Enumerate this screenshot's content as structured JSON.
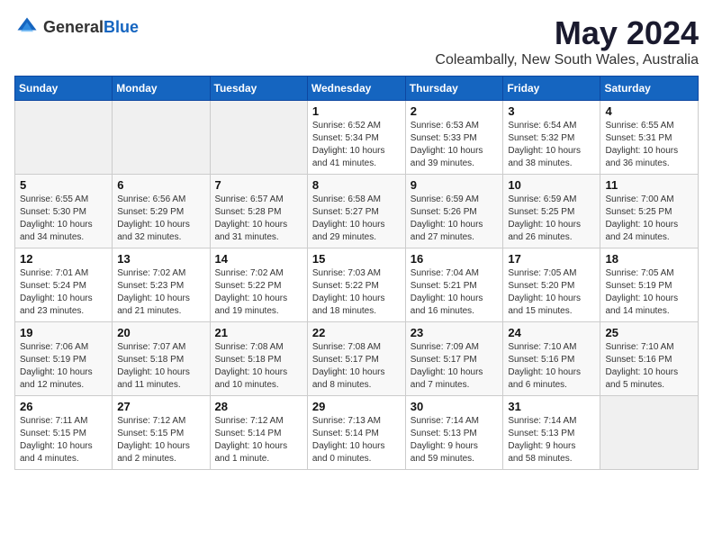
{
  "header": {
    "logo_general": "General",
    "logo_blue": "Blue",
    "title": "May 2024",
    "subtitle": "Coleambally, New South Wales, Australia"
  },
  "weekdays": [
    "Sunday",
    "Monday",
    "Tuesday",
    "Wednesday",
    "Thursday",
    "Friday",
    "Saturday"
  ],
  "weeks": [
    [
      {
        "day": "",
        "info": ""
      },
      {
        "day": "",
        "info": ""
      },
      {
        "day": "",
        "info": ""
      },
      {
        "day": "1",
        "info": "Sunrise: 6:52 AM\nSunset: 5:34 PM\nDaylight: 10 hours\nand 41 minutes."
      },
      {
        "day": "2",
        "info": "Sunrise: 6:53 AM\nSunset: 5:33 PM\nDaylight: 10 hours\nand 39 minutes."
      },
      {
        "day": "3",
        "info": "Sunrise: 6:54 AM\nSunset: 5:32 PM\nDaylight: 10 hours\nand 38 minutes."
      },
      {
        "day": "4",
        "info": "Sunrise: 6:55 AM\nSunset: 5:31 PM\nDaylight: 10 hours\nand 36 minutes."
      }
    ],
    [
      {
        "day": "5",
        "info": "Sunrise: 6:55 AM\nSunset: 5:30 PM\nDaylight: 10 hours\nand 34 minutes."
      },
      {
        "day": "6",
        "info": "Sunrise: 6:56 AM\nSunset: 5:29 PM\nDaylight: 10 hours\nand 32 minutes."
      },
      {
        "day": "7",
        "info": "Sunrise: 6:57 AM\nSunset: 5:28 PM\nDaylight: 10 hours\nand 31 minutes."
      },
      {
        "day": "8",
        "info": "Sunrise: 6:58 AM\nSunset: 5:27 PM\nDaylight: 10 hours\nand 29 minutes."
      },
      {
        "day": "9",
        "info": "Sunrise: 6:59 AM\nSunset: 5:26 PM\nDaylight: 10 hours\nand 27 minutes."
      },
      {
        "day": "10",
        "info": "Sunrise: 6:59 AM\nSunset: 5:25 PM\nDaylight: 10 hours\nand 26 minutes."
      },
      {
        "day": "11",
        "info": "Sunrise: 7:00 AM\nSunset: 5:25 PM\nDaylight: 10 hours\nand 24 minutes."
      }
    ],
    [
      {
        "day": "12",
        "info": "Sunrise: 7:01 AM\nSunset: 5:24 PM\nDaylight: 10 hours\nand 23 minutes."
      },
      {
        "day": "13",
        "info": "Sunrise: 7:02 AM\nSunset: 5:23 PM\nDaylight: 10 hours\nand 21 minutes."
      },
      {
        "day": "14",
        "info": "Sunrise: 7:02 AM\nSunset: 5:22 PM\nDaylight: 10 hours\nand 19 minutes."
      },
      {
        "day": "15",
        "info": "Sunrise: 7:03 AM\nSunset: 5:22 PM\nDaylight: 10 hours\nand 18 minutes."
      },
      {
        "day": "16",
        "info": "Sunrise: 7:04 AM\nSunset: 5:21 PM\nDaylight: 10 hours\nand 16 minutes."
      },
      {
        "day": "17",
        "info": "Sunrise: 7:05 AM\nSunset: 5:20 PM\nDaylight: 10 hours\nand 15 minutes."
      },
      {
        "day": "18",
        "info": "Sunrise: 7:05 AM\nSunset: 5:19 PM\nDaylight: 10 hours\nand 14 minutes."
      }
    ],
    [
      {
        "day": "19",
        "info": "Sunrise: 7:06 AM\nSunset: 5:19 PM\nDaylight: 10 hours\nand 12 minutes."
      },
      {
        "day": "20",
        "info": "Sunrise: 7:07 AM\nSunset: 5:18 PM\nDaylight: 10 hours\nand 11 minutes."
      },
      {
        "day": "21",
        "info": "Sunrise: 7:08 AM\nSunset: 5:18 PM\nDaylight: 10 hours\nand 10 minutes."
      },
      {
        "day": "22",
        "info": "Sunrise: 7:08 AM\nSunset: 5:17 PM\nDaylight: 10 hours\nand 8 minutes."
      },
      {
        "day": "23",
        "info": "Sunrise: 7:09 AM\nSunset: 5:17 PM\nDaylight: 10 hours\nand 7 minutes."
      },
      {
        "day": "24",
        "info": "Sunrise: 7:10 AM\nSunset: 5:16 PM\nDaylight: 10 hours\nand 6 minutes."
      },
      {
        "day": "25",
        "info": "Sunrise: 7:10 AM\nSunset: 5:16 PM\nDaylight: 10 hours\nand 5 minutes."
      }
    ],
    [
      {
        "day": "26",
        "info": "Sunrise: 7:11 AM\nSunset: 5:15 PM\nDaylight: 10 hours\nand 4 minutes."
      },
      {
        "day": "27",
        "info": "Sunrise: 7:12 AM\nSunset: 5:15 PM\nDaylight: 10 hours\nand 2 minutes."
      },
      {
        "day": "28",
        "info": "Sunrise: 7:12 AM\nSunset: 5:14 PM\nDaylight: 10 hours\nand 1 minute."
      },
      {
        "day": "29",
        "info": "Sunrise: 7:13 AM\nSunset: 5:14 PM\nDaylight: 10 hours\nand 0 minutes."
      },
      {
        "day": "30",
        "info": "Sunrise: 7:14 AM\nSunset: 5:13 PM\nDaylight: 9 hours\nand 59 minutes."
      },
      {
        "day": "31",
        "info": "Sunrise: 7:14 AM\nSunset: 5:13 PM\nDaylight: 9 hours\nand 58 minutes."
      },
      {
        "day": "",
        "info": ""
      }
    ]
  ]
}
